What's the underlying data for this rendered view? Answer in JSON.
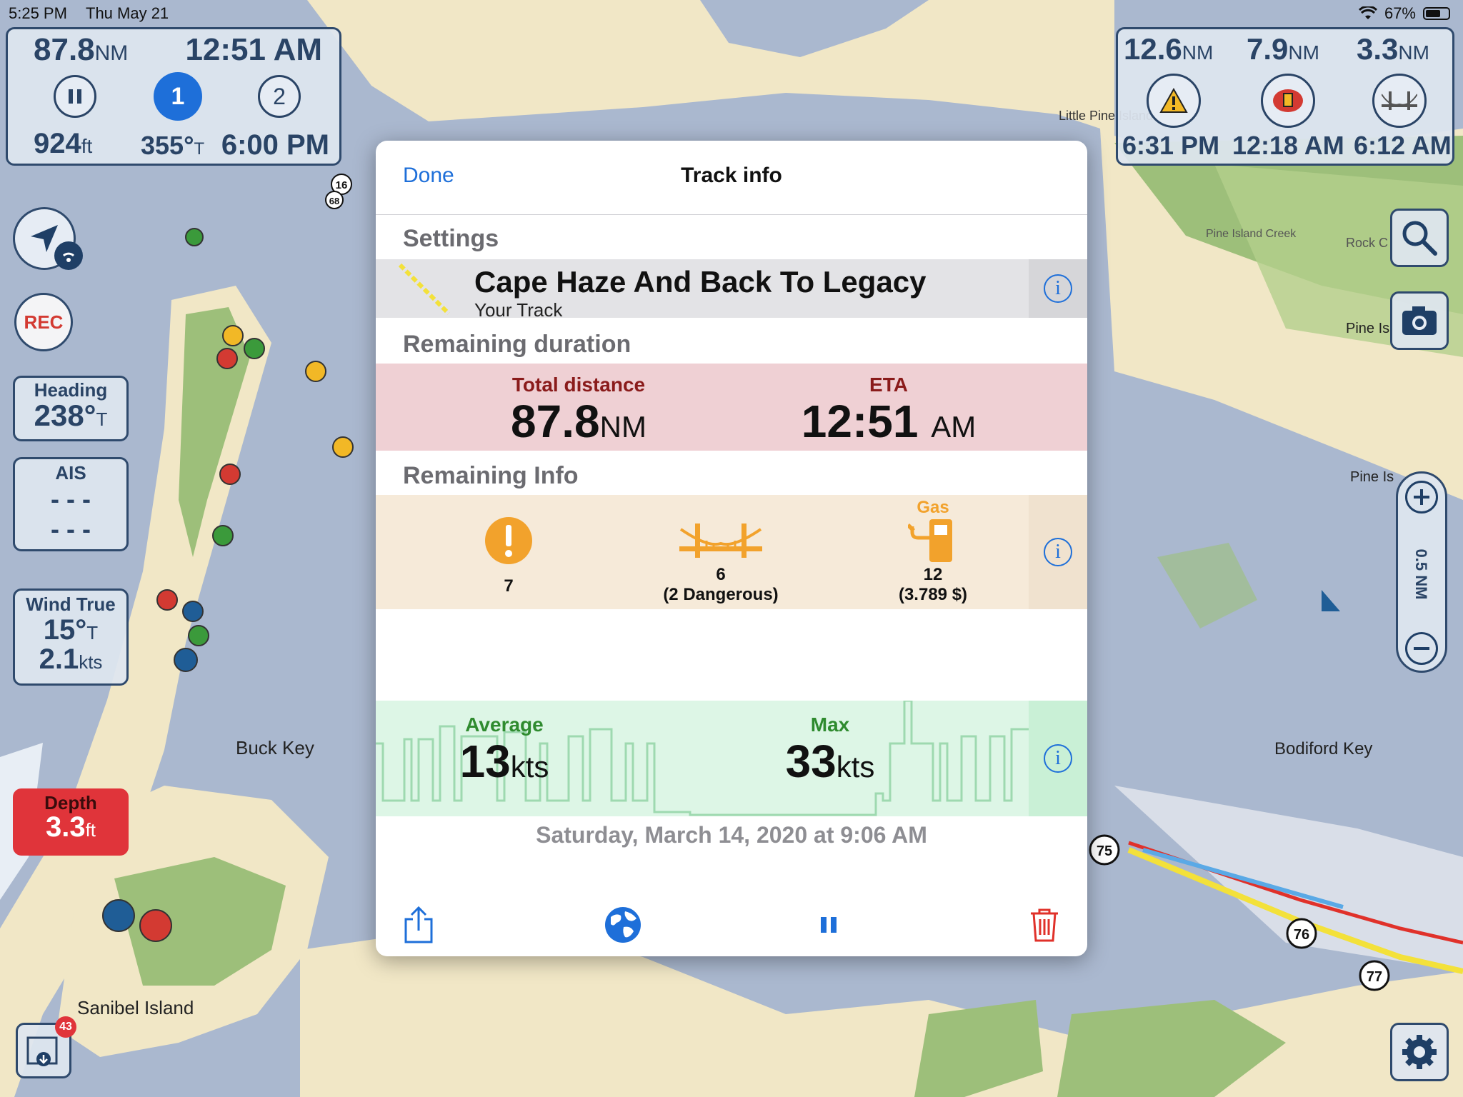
{
  "status_bar": {
    "time": "5:25 PM",
    "date": "Thu May 21",
    "battery": "67%",
    "battery_level": 0.67
  },
  "nav_panel_left": {
    "distance": "87.8",
    "distance_unit": "NM",
    "eta": "12:51 AM",
    "route_point_1": "1",
    "route_point_2": "2",
    "depth": "924",
    "depth_unit": "ft",
    "course": "355°",
    "course_unit": "T",
    "time": "6:00 PM"
  },
  "nav_panel_right": {
    "items": [
      {
        "distance": "12.6",
        "unit": "NM",
        "time": "6:31 PM",
        "icon": "warning-icon"
      },
      {
        "distance": "7.9",
        "unit": "NM",
        "time": "12:18 AM",
        "icon": "fuel-icon"
      },
      {
        "distance": "3.3",
        "unit": "NM",
        "time": "6:12 AM",
        "icon": "bridge-icon"
      }
    ]
  },
  "side_left": {
    "rec_label": "REC",
    "heading_label": "Heading",
    "heading_value": "238°",
    "heading_unit": "T",
    "ais_label": "AIS",
    "ais_line1": "- - -",
    "ais_line2": "- - -",
    "wind_label": "Wind True",
    "wind_dir": "15°",
    "wind_dir_unit": "T",
    "wind_speed": "2.1",
    "wind_speed_unit": "kts",
    "depth_label": "Depth",
    "depth_value": "3.3",
    "depth_unit": "ft",
    "download_badge": "43"
  },
  "side_right": {
    "zoom_scale": "0.5 NM"
  },
  "map_labels": {
    "buck_key": "Buck Key",
    "sanibel": "Sanibel Island",
    "bodiford": "Bodiford Key",
    "little_pine": "Little Pine Island",
    "pine_island_creek": "Pine Island Creek",
    "pine_is": "Pine Is",
    "pine_is2": "Pine Is",
    "rock_c": "Rock C",
    "marker_75": "75",
    "marker_76": "76",
    "marker_77": "77",
    "marker_16": "16",
    "marker_68": "68"
  },
  "modal": {
    "done": "Done",
    "title": "Track info",
    "settings_header": "Settings",
    "track_name": "Cape Haze And Back To Legacy",
    "track_sub": "Your Track",
    "duration_header": "Remaining duration",
    "total_distance_label": "Total distance",
    "total_distance_value": "87.8",
    "total_distance_unit": "NM",
    "eta_label": "ETA",
    "eta_value": "12:51",
    "eta_unit": "AM",
    "remaining_header": "Remaining Info",
    "warnings_count": "7",
    "bridges_count": "6",
    "bridges_note": "(2 Dangerous)",
    "gas_label": "Gas",
    "gas_count": "12",
    "gas_price": "(3.789 $)",
    "avg_label": "Average",
    "avg_value": "13",
    "avg_unit": "kts",
    "max_label": "Max",
    "max_value": "33",
    "max_unit": "kts",
    "date": "Saturday, March 14, 2020 at 9:06 AM"
  },
  "colors": {
    "accent": "#1e6fd9",
    "danger": "#e0312a",
    "warning": "#f2a22c",
    "speed_green": "#2f8b2f",
    "duration_bg": "#efd0d4"
  }
}
